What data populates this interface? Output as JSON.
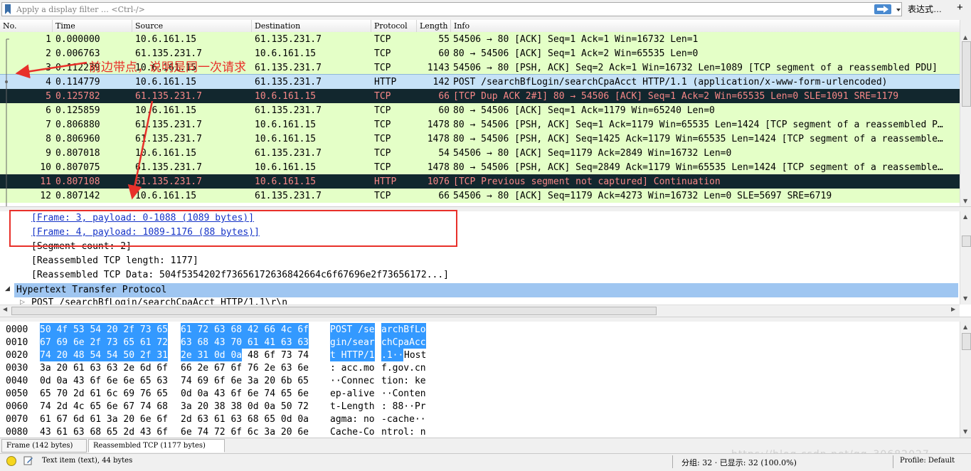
{
  "filter": {
    "placeholder": "Apply a display filter … <Ctrl-/>",
    "expression_label": "表达式…",
    "add_label": "+"
  },
  "columns": [
    "No.",
    "Time",
    "Source",
    "Destination",
    "Protocol",
    "Length",
    "Info"
  ],
  "packets": [
    {
      "no": "1",
      "time": "0.000000",
      "src": "10.6.161.15",
      "dst": "61.135.231.7",
      "proto": "TCP",
      "len": "55",
      "info": "54506 → 80 [ACK] Seq=1 Ack=1 Win=16732 Len=1",
      "style": "normal"
    },
    {
      "no": "2",
      "time": "0.006763",
      "src": "61.135.231.7",
      "dst": "10.6.161.15",
      "proto": "TCP",
      "len": "60",
      "info": "80 → 54506 [ACK] Seq=1 Ack=2 Win=65535 Len=0",
      "style": "normal"
    },
    {
      "no": "3",
      "time": "0.112239",
      "src": "10.6.161.15",
      "dst": "61.135.231.7",
      "proto": "TCP",
      "len": "1143",
      "info": "54506 → 80 [PSH, ACK] Seq=2 Ack=1 Win=16732 Len=1089 [TCP segment of a reassembled PDU]",
      "style": "normal"
    },
    {
      "no": "4",
      "time": "0.114779",
      "src": "10.6.161.15",
      "dst": "61.135.231.7",
      "proto": "HTTP",
      "len": "142",
      "info": "POST /searchBfLogin/searchCpaAcct HTTP/1.1  (application/x-www-form-urlencoded)",
      "style": "selected"
    },
    {
      "no": "5",
      "time": "0.125782",
      "src": "61.135.231.7",
      "dst": "10.6.161.15",
      "proto": "TCP",
      "len": "66",
      "info": "[TCP Dup ACK 2#1] 80 → 54506 [ACK] Seq=1 Ack=2 Win=65535 Len=0 SLE=1091 SRE=1179",
      "style": "bad"
    },
    {
      "no": "6",
      "time": "0.125859",
      "src": "10.6.161.15",
      "dst": "61.135.231.7",
      "proto": "TCP",
      "len": "60",
      "info": "80 → 54506 [ACK] Seq=1 Ack=1179 Win=65240 Len=0",
      "style": "normal"
    },
    {
      "no": "7",
      "time": "0.806880",
      "src": "61.135.231.7",
      "dst": "10.6.161.15",
      "proto": "TCP",
      "len": "1478",
      "info": "80 → 54506 [PSH, ACK] Seq=1 Ack=1179 Win=65535 Len=1424 [TCP segment of a reassembled P…",
      "style": "normal"
    },
    {
      "no": "8",
      "time": "0.806960",
      "src": "61.135.231.7",
      "dst": "10.6.161.15",
      "proto": "TCP",
      "len": "1478",
      "info": "80 → 54506 [PSH, ACK] Seq=1425 Ack=1179 Win=65535 Len=1424 [TCP segment of a reassemble…",
      "style": "normal"
    },
    {
      "no": "9",
      "time": "0.807018",
      "src": "10.6.161.15",
      "dst": "61.135.231.7",
      "proto": "TCP",
      "len": "54",
      "info": "54506 → 80 [ACK] Seq=1179 Ack=2849 Win=16732 Len=0",
      "style": "normal"
    },
    {
      "no": "10",
      "time": "0.807075",
      "src": "61.135.231.7",
      "dst": "10.6.161.15",
      "proto": "TCP",
      "len": "1478",
      "info": "80 → 54506 [PSH, ACK] Seq=2849 Ack=1179 Win=65535 Len=1424 [TCP segment of a reassemble…",
      "style": "normal"
    },
    {
      "no": "11",
      "time": "0.807108",
      "src": "61.135.231.7",
      "dst": "10.6.161.15",
      "proto": "HTTP",
      "len": "1076",
      "info": "[TCP Previous segment not captured] Continuation",
      "style": "bad"
    },
    {
      "no": "12",
      "time": "0.807142",
      "src": "10.6.161.15",
      "dst": "61.135.231.7",
      "proto": "TCP",
      "len": "66",
      "info": "54506 → 80 [ACK] Seq=1179 Ack=4273 Win=16732 Len=0 SLE=5697 SRE=6719",
      "style": "normal"
    }
  ],
  "details": [
    {
      "text": "[Frame: 3, payload: 0-1088 (1089 bytes)]",
      "kind": "link"
    },
    {
      "text": "[Frame: 4, payload: 1089-1176 (88 bytes)]",
      "kind": "link"
    },
    {
      "text": "[Segment count: 2]",
      "kind": "plain"
    },
    {
      "text": "[Reassembled TCP length: 1177]",
      "kind": "plain"
    },
    {
      "text": "[Reassembled TCP Data: 504f5354202f73656172636842664c6f67696e2f73656172...]",
      "kind": "plain"
    },
    {
      "text": "Hypertext Transfer Protocol",
      "kind": "section"
    },
    {
      "text": "POST /searchBfLogin/searchCpaAcct HTTP/1.1\\r\\n",
      "kind": "child"
    }
  ],
  "bytes": [
    {
      "off": "0000",
      "h1": "50 4f 53 54 20 2f 73 65",
      "h2": "61 72 63 68 42 66 4c 6f",
      "a1": "POST /se",
      "a2": "archBfLo",
      "hl": "full"
    },
    {
      "off": "0010",
      "h1": "67 69 6e 2f 73 65 61 72",
      "h2": "63 68 43 70 61 41 63 63",
      "a1": "gin/sear",
      "a2": "chCpaAcc",
      "hl": "full"
    },
    {
      "off": "0020",
      "h1": "74 20 48 54 54 50 2f 31",
      "h2": "2e 31 0d 0a",
      "h3": "48 6f 73 74",
      "a1": "t HTTP/1",
      "a2": ".1··",
      "a3": "Host",
      "hl": "partial"
    },
    {
      "off": "0030",
      "h1": "3a 20 61 63 63 2e 6d 6f",
      "h2": "66 2e 67 6f 76 2e 63 6e",
      "a1": ": acc.mo",
      "a2": "f.gov.cn",
      "hl": "none"
    },
    {
      "off": "0040",
      "h1": "0d 0a 43 6f 6e 6e 65 63",
      "h2": "74 69 6f 6e 3a 20 6b 65",
      "a1": "··Connec",
      "a2": "tion: ke",
      "hl": "none"
    },
    {
      "off": "0050",
      "h1": "65 70 2d 61 6c 69 76 65",
      "h2": "0d 0a 43 6f 6e 74 65 6e",
      "a1": "ep-alive",
      "a2": "··Conten",
      "hl": "none"
    },
    {
      "off": "0060",
      "h1": "74 2d 4c 65 6e 67 74 68",
      "h2": "3a 20 38 38 0d 0a 50 72",
      "a1": "t-Length",
      "a2": ": 88··Pr",
      "hl": "none"
    },
    {
      "off": "0070",
      "h1": "61 67 6d 61 3a 20 6e 6f",
      "h2": "2d 63 61 63 68 65 0d 0a",
      "a1": "agma: no",
      "a2": "-cache··",
      "hl": "none"
    },
    {
      "off": "0080",
      "h1": "43 61 63 68 65 2d 43 6f",
      "h2": "6e 74 72 6f 6c 3a 20 6e",
      "a1": "Cache-Co",
      "a2": "ntrol: n",
      "hl": "none"
    }
  ],
  "tabs": [
    "Frame (142 bytes)",
    "Reassembled TCP (1177 bytes)"
  ],
  "status": {
    "text": "Text item (text), 44 bytes",
    "packets": "分组: 32 · 已显示: 32 (100.0%)",
    "profile": "Profile: Default"
  },
  "annotation": {
    "text": "前边带点，说明是同一次请求"
  },
  "watermark": "https://blog.csdn.net/qq_30682027",
  "colors": {
    "tcp_row": "#e4ffc7",
    "selected_row": "#c6e2f7",
    "bad_row_bg": "#12272e",
    "bad_row_fg": "#f78787",
    "annotation": "#e8302a",
    "byte_highlight": "#3399ff"
  }
}
